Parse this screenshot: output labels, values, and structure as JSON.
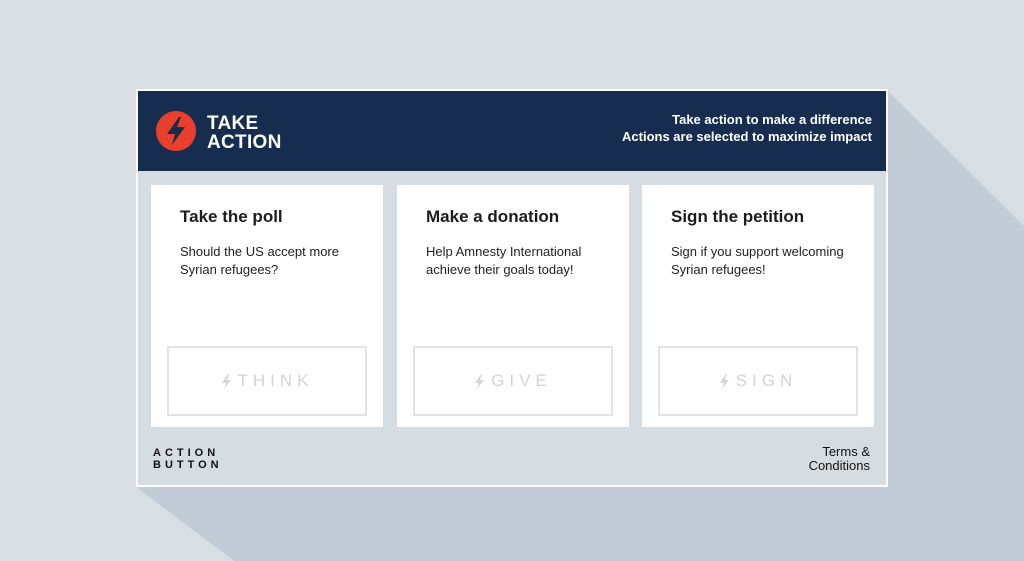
{
  "header": {
    "brand_line1": "TAKE",
    "brand_line2": "ACTION",
    "tagline_line1": "Take action to make a difference",
    "tagline_line2": "Actions are selected to maximize impact",
    "logo_icon": "lightning-bolt-icon",
    "colors": {
      "background": "#172d50",
      "logo": "#e8402c"
    }
  },
  "cards": [
    {
      "title": "Take the poll",
      "description": "Should the US accept more Syrian refugees?",
      "button_label": "THINK",
      "button_icon": "lightning-bolt-icon"
    },
    {
      "title": "Make a donation",
      "description": "Help Amnesty International achieve their goals today!",
      "button_label": "GIVE",
      "button_icon": "lightning-bolt-icon"
    },
    {
      "title": "Sign the petition",
      "description": "Sign if you support welcoming Syrian refugees!",
      "button_label": "SIGN",
      "button_icon": "lightning-bolt-icon"
    }
  ],
  "footer": {
    "logo_line1": "ACTION",
    "logo_line2": "BUTTON",
    "terms_line1": "Terms &",
    "terms_line2": "Conditions"
  }
}
